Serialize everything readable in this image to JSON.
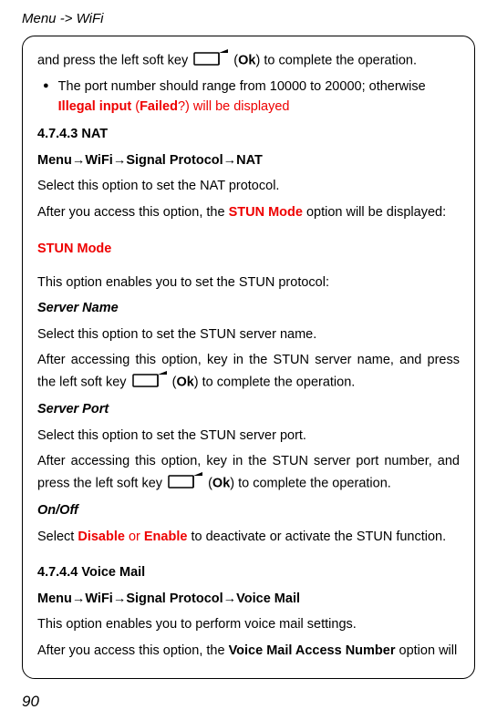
{
  "header": "Menu -> WiFi",
  "line1_a": "and press the left soft key ",
  "line1_b": " (",
  "line1_ok": "Ok",
  "line1_c": ") to complete the operation.",
  "bullet1_a": "The port number should range from 10000 to 20000; otherwise ",
  "bullet1_b": "Illegal input",
  "bullet1_c": " (",
  "bullet1_d": "Failed",
  "bullet1_e": "?) will be displayed",
  "h_nat": "4.7.4.3 NAT",
  "nat_path": "Menu→WiFi→Signal Protocol→NAT",
  "nat_p1": "Select this option to set the NAT protocol.",
  "nat_p2a": "After you access this option, the ",
  "nat_p2b": "STUN Mode",
  "nat_p2c": " option will be displayed:",
  "stun_mode": "STUN Mode",
  "stun_p1": "This option enables you to set the STUN protocol:",
  "server_name": "Server Name",
  "server_name_p1": "Select this option to set the STUN server name.",
  "server_name_p2a": "After accessing this option, key in the STUN server name, and press the left soft key ",
  "server_name_p2b": " (",
  "server_name_p2ok": "Ok",
  "server_name_p2c": ") to complete the operation.",
  "server_port": "Server Port",
  "server_port_p1": "Select this option to set the STUN server port.",
  "server_port_p2a": "After accessing this option, key in the STUN server port number, and press the left soft key ",
  "server_port_p2b": " (",
  "server_port_p2ok": "Ok",
  "server_port_p2c": ") to complete the operation.",
  "onoff": "On/Off",
  "onoff_p1a": "Select ",
  "onoff_p1b": "Disable",
  "onoff_p1c": " or ",
  "onoff_p1d": "Enable",
  "onoff_p1e": " to deactivate or activate the STUN function.",
  "h_vm": "4.7.4.4 Voice Mail",
  "vm_path": "Menu→WiFi→Signal Protocol→Voice Mail",
  "vm_p1": "This option enables you to perform voice mail settings.",
  "vm_p2a": "After you access this option, the ",
  "vm_p2b": "Voice Mail Access Number",
  "vm_p2c": " option will",
  "page_num": "90"
}
